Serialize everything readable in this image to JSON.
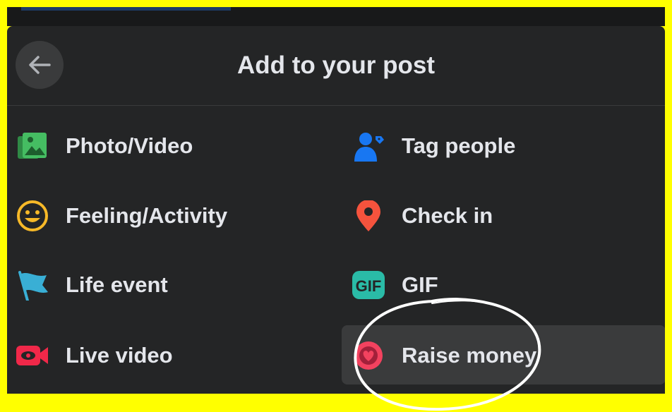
{
  "dialog": {
    "title": "Add to your post"
  },
  "options": [
    {
      "label": "Photo/Video",
      "icon": "photo-video-icon",
      "color": "#45bd62"
    },
    {
      "label": "Tag people",
      "icon": "tag-people-icon",
      "color": "#1877f2"
    },
    {
      "label": "Feeling/Activity",
      "icon": "feeling-icon",
      "color": "#f7b928"
    },
    {
      "label": "Check in",
      "icon": "location-pin-icon",
      "color": "#f5533d"
    },
    {
      "label": "Life event",
      "icon": "flag-icon",
      "color": "#39afd5"
    },
    {
      "label": "GIF",
      "icon": "gif-icon",
      "color": "#2abba7"
    },
    {
      "label": "Live video",
      "icon": "live-video-icon",
      "color": "#f02849"
    },
    {
      "label": "Raise money",
      "icon": "raise-money-icon",
      "color": "#f3425f"
    }
  ],
  "gif_icon_text": "GIF",
  "colors": {
    "frame": "#ffff00",
    "panel": "#242526",
    "highlight": "#3a3b3c",
    "text": "#e4e6eb"
  }
}
